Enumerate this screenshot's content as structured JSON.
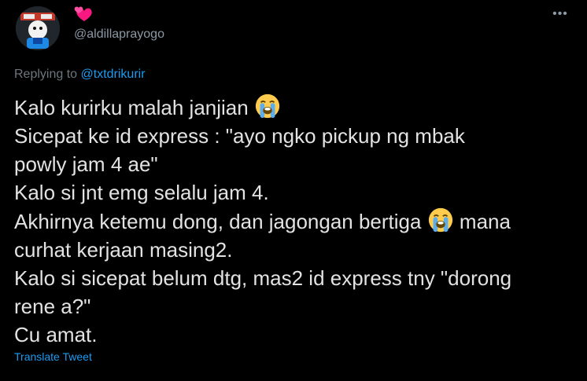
{
  "author": {
    "display_name_icon": "two-hearts-icon",
    "handle": "@aldillaprayogo",
    "avatar_icon": "avatar-cartoon"
  },
  "more_label": "•••",
  "reply": {
    "prefix": "Replying to ",
    "target": "@txtdrikurir"
  },
  "tweet": {
    "line1": "Kalo kurirku malah janjian ",
    "line2": "Sicepat ke id express : \"ayo ngko pickup ng mbak",
    "line3": "powly jam 4 ae\"",
    "line4": "Kalo si jnt emg selalu jam 4.",
    "line5a": "Akhirnya ketemu dong, dan jagongan bertiga ",
    "line5b": " mana",
    "line6": "curhat kerjaan masing2.",
    "line7": "Kalo si sicepat belum dtg, mas2 id express tny \"dorong",
    "line8": "rene a?\"",
    "line9": "Cu amat.",
    "emoji_icon": "loudly-crying-face-icon"
  },
  "translate_label": "Translate Tweet",
  "colors": {
    "background": "#000000",
    "text": "#e2e2e2",
    "muted": "#6e767d",
    "link": "#1d9bf0",
    "heart": "#f91880"
  }
}
